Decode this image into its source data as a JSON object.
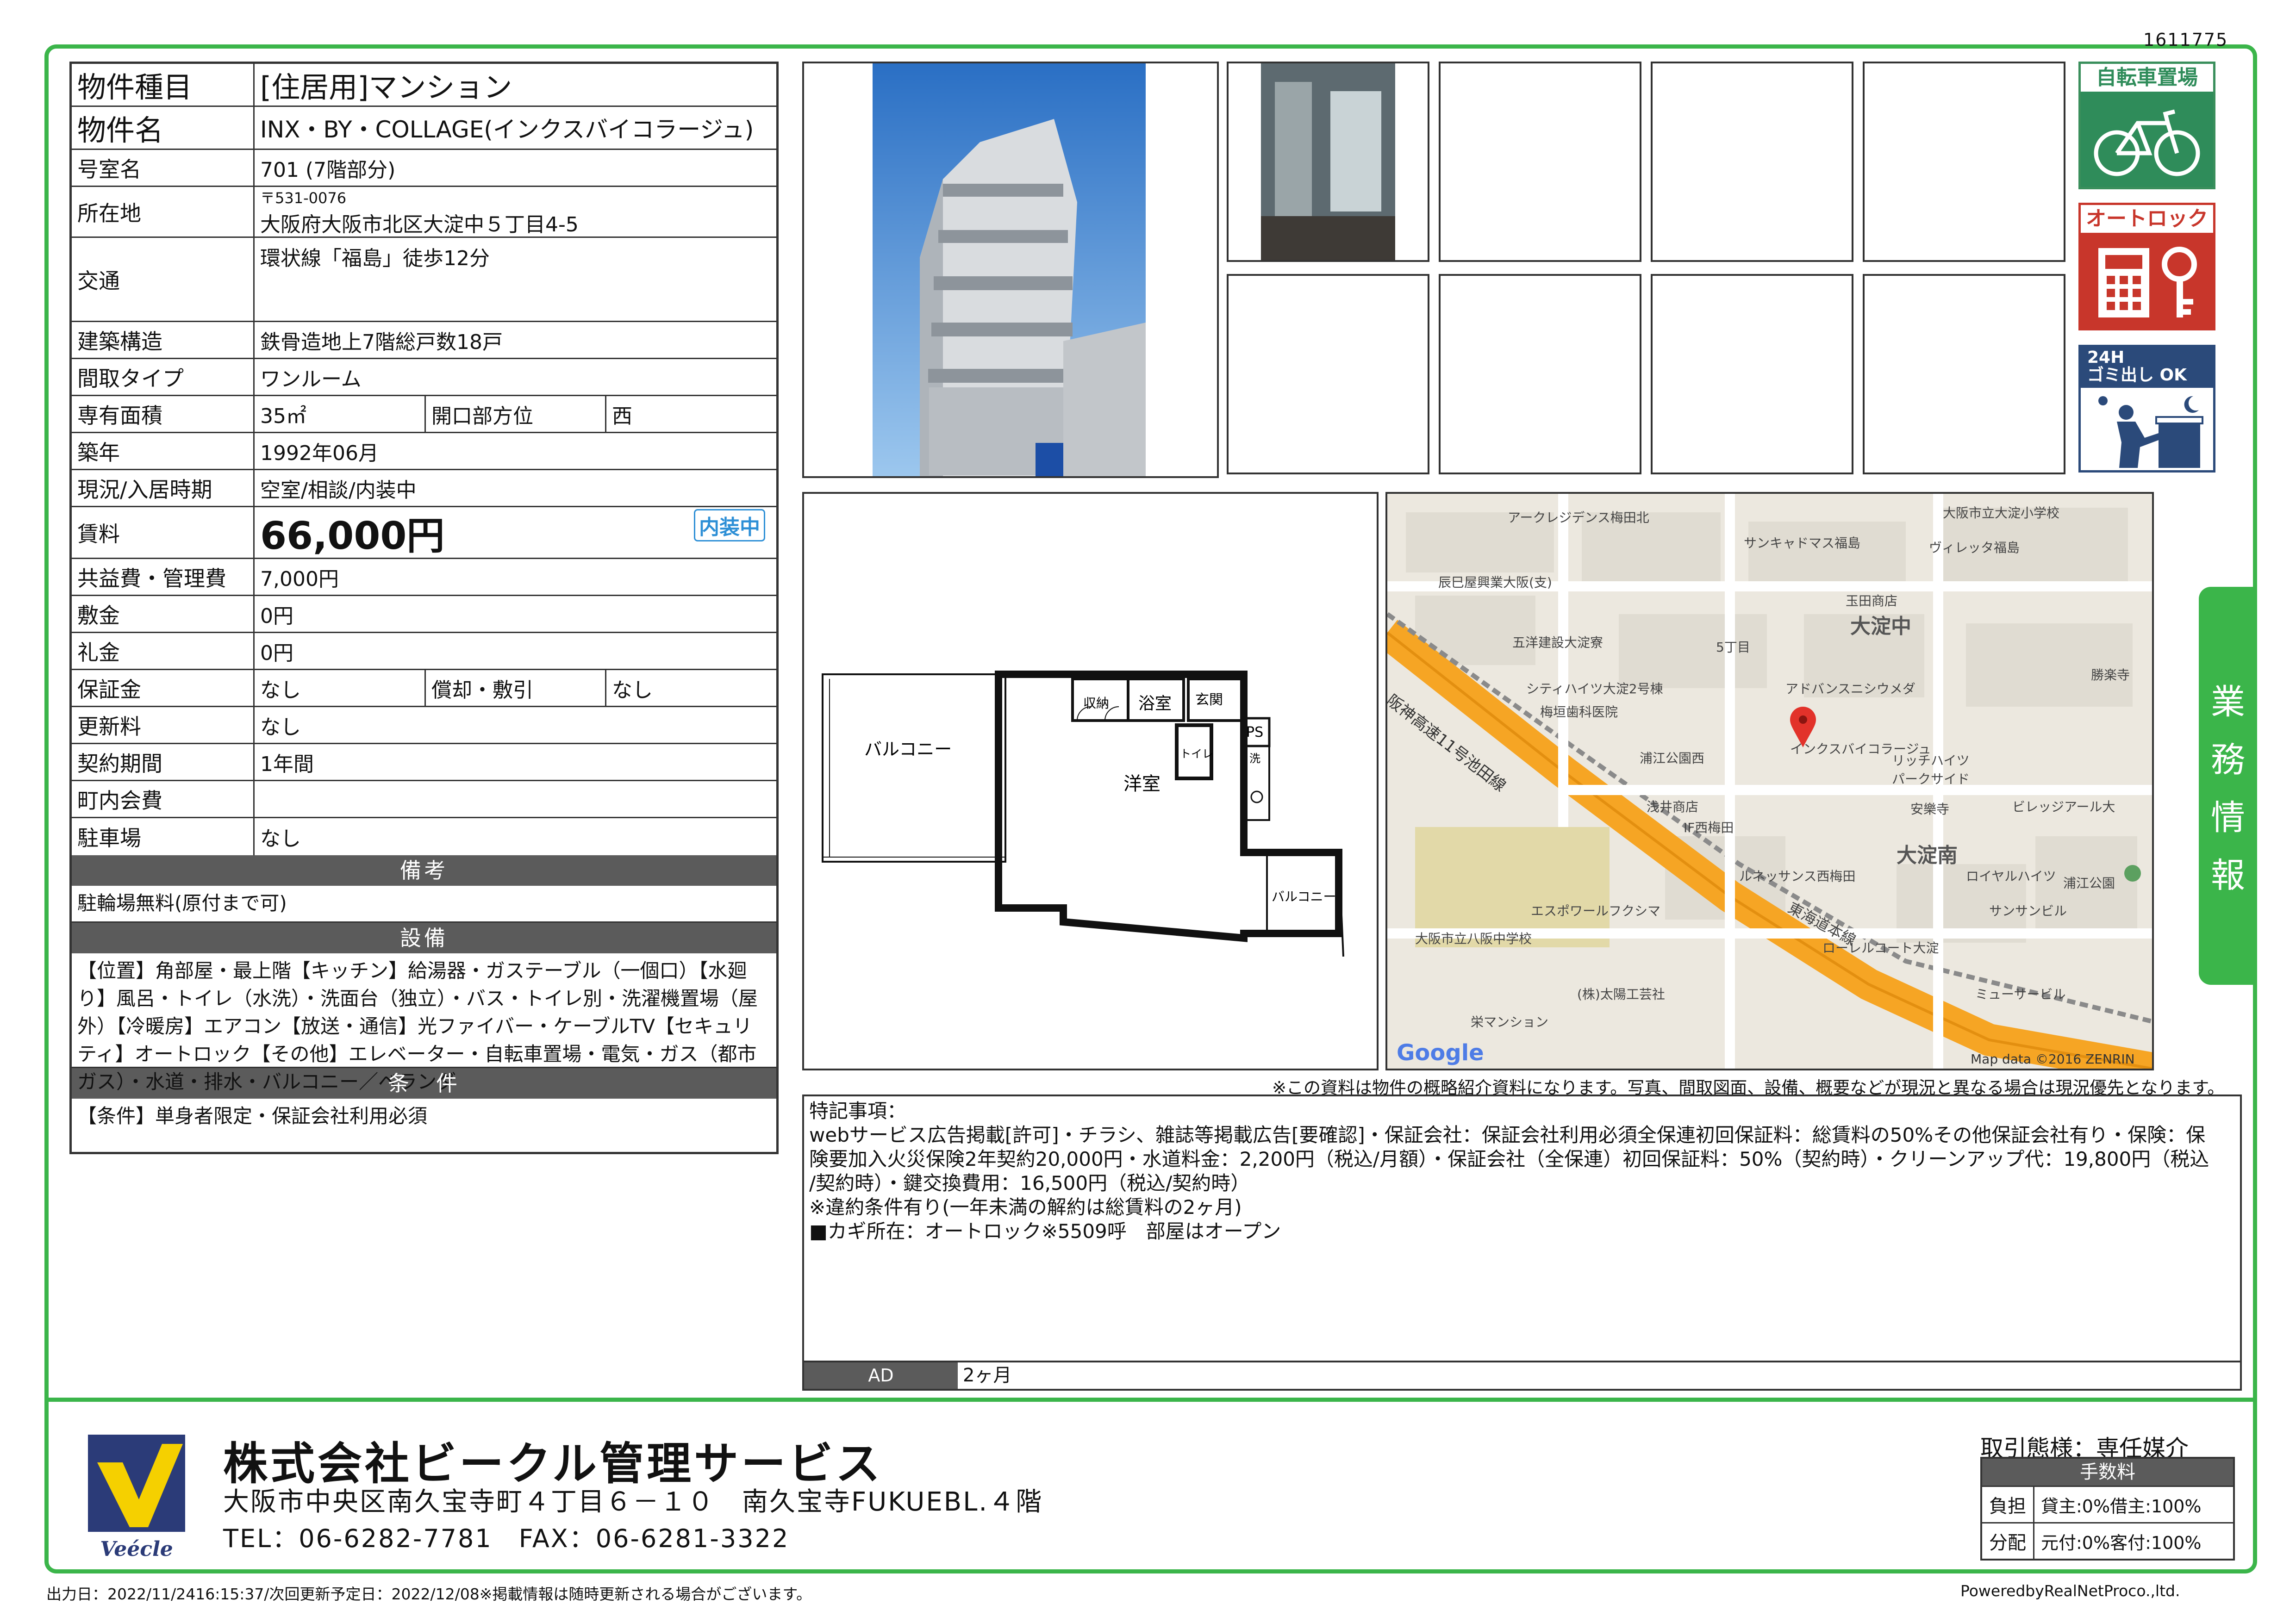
{
  "doc_id": "1611775",
  "info": {
    "type_label": "物件種目",
    "type_value": "[住居用]マンション",
    "name_label": "物件名",
    "name_value": "INX・BY・COLLAGE(インクスバイコラージュ)",
    "room_label": "号室名",
    "room_value": "701 (7階部分)",
    "address_label": "所在地",
    "postal": "〒531-0076",
    "address_value": "大阪府大阪市北区大淀中５丁目4-5",
    "access_label": "交通",
    "access_value": "環状線「福島」徒歩12分",
    "structure_label": "建築構造",
    "structure_value": "鉄骨造地上7階総戸数18戸",
    "layout_label": "間取タイプ",
    "layout_value": "ワンルーム",
    "area_label": "専有面積",
    "area_value": "35㎡",
    "direction_label": "開口部方位",
    "direction_value": "西",
    "built_label": "築年",
    "built_value": "1992年06月",
    "status_label": "現況/入居時期",
    "status_value": "空室/相談/内装中",
    "rent_label": "賃料",
    "rent_value": "66,000円",
    "rent_badge": "内装中",
    "common_label": "共益費・管理費",
    "common_value": "7,000円",
    "deposit_label": "敷金",
    "deposit_value": "0円",
    "key_label": "礼金",
    "key_value": "0円",
    "guarantee_label": "保証金",
    "guarantee_value": "なし",
    "amort_label": "償却・敷引",
    "amort_value": "なし",
    "renewal_label": "更新料",
    "renewal_value": "なし",
    "contract_label": "契約期間",
    "contract_value": "1年間",
    "town_label": "町内会費",
    "town_value": "",
    "parking_label": "駐車場",
    "parking_value": "なし",
    "remarks_head": "備考",
    "remarks_text": "駐輪場無料(原付まで可)",
    "equip_head": "設備",
    "equip_text": "【位置】角部屋・最上階【キッチン】給湯器・ガステーブル（一個口）【水廻り】風呂・トイレ（水洗）・洗面台（独立）・バス・トイレ別・洗濯機置場（屋外）【冷暖房】エアコン【放送・通信】光ファイバー・ケーブルTV【セキュリティ】オートロック【その他】エレベーター・自転車置場・電気・ガス（都市ガス）・水道・排水・バルコニー／ベランダ",
    "cond_head": "条　件",
    "cond_text": "【条件】単身者限定・保証会社利用必須"
  },
  "badges": {
    "bicycle": "自転車置場",
    "autolock": "オートロック",
    "garbage_line1": "24H",
    "garbage_line2": "ゴミ出し OK"
  },
  "floorplan": {
    "balcony_left": "バルコニー",
    "storage": "収納",
    "bath": "浴室",
    "entrance": "玄関",
    "toilet": "トイレ",
    "ps": "PS",
    "laundry": "洗",
    "room": "洋室",
    "balcony_right": "バルコニー"
  },
  "map": {
    "labels": [
      "アークレジデンス梅田北",
      "大阪市立大淀小学校",
      "サンキャドマス福島",
      "ヴィレッタ福島",
      "辰巳屋興業大阪(支)",
      "玉田商店",
      "五洋建設大淀寮",
      "5丁目",
      "勝楽寺",
      "シティハイツ大淀2号棟",
      "アドバンスニシウメダ",
      "梅垣歯科医院",
      "インクスバイコラージュ",
      "浦江公園西",
      "リッチハイツ",
      "パークサイド",
      "浅井商店",
      "安樂寺",
      "ビレッジアール大",
      "IF西梅田",
      "ルネッサンス西梅田",
      "ロイヤルハイツ",
      "浦江公園",
      "エスポワールフクシマ",
      "サンサンビル",
      "大阪市立八阪中学校",
      "ローレルコート大淀",
      "ミューサービル",
      "(株)太陽工芸社",
      "栄マンション",
      "東海道本線",
      "阪神高速11号池田線"
    ],
    "district_1": "大淀中",
    "district_2": "大淀南",
    "google": "Google",
    "credit": "Map data ©2016 ZENRIN"
  },
  "disclaimer": "※この資料は物件の概略紹介資料になります。写真、間取図面、設備、概要などが現況と異なる場合は現況優先となります。",
  "special": {
    "line1": "特記事項：",
    "line2": "webサービス広告掲載[許可]・チラシ、雑誌等掲載広告[要確認]・保証会社：保証会社利用必須全保連初回保証料：総賃料の50%その他保証会社有り・保険：保",
    "line3": "険要加入火災保険2年契約20,000円・水道料金：2,200円（税込/月額）・保証会社（全保連）初回保証料：50%（契約時）・クリーンアップ代：19,800円（税込",
    "line4": "/契約時）・鍵交換費用：16,500円（税込/契約時）",
    "line5": "※違約条件有り(一年未満の解約は総賃料の2ヶ月)",
    "line6": "■カギ所在：オートロック※5509呼　部屋はオープン"
  },
  "ad": {
    "label": "AD",
    "value": "2ヶ月"
  },
  "side_tab": [
    "業",
    "務",
    "情",
    "報"
  ],
  "company": {
    "logo_text": "Veécle",
    "name": "株式会社ビークル管理サービス",
    "address": "大阪市中央区南久宝寺町４丁目６－１０　南久宝寺FUKUEBL.４階",
    "tel": "TEL：06-6282-7781　FAX：06-6281-3322"
  },
  "deal": {
    "type": "取引態様：専任媒介",
    "fee_head": "手数料",
    "burden_label": "負担",
    "burden_value": "貸主:0%借主:100%",
    "split_label": "分配",
    "split_value": "元付:0%客付:100%"
  },
  "footer": {
    "output": "出力日：2022/11/2416:15:37/次回更新予定日：2022/12/08※掲載情報は随時更新される場合がございます。",
    "powered": "PoweredbyRealNetProco.,ltd."
  },
  "colors": {
    "frame_green": "#3bb54a",
    "header_gray": "#5b5b5b",
    "rent_badge": "#2d8fd6",
    "badge_red": "#c8362b",
    "badge_green": "#2f8c5a",
    "map_road": "#f6a524"
  }
}
